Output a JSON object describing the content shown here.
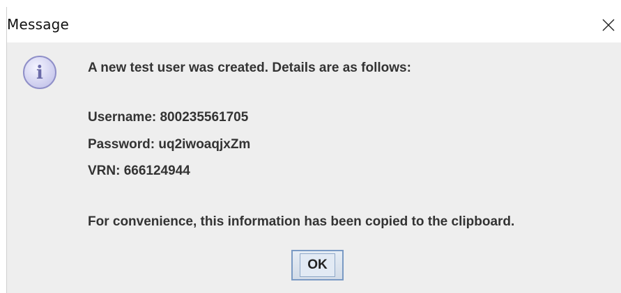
{
  "dialog": {
    "title": "Message",
    "close_icon": "close-icon",
    "info_icon": "info-icon",
    "info_icon_glyph": "i",
    "message": {
      "intro": "A new test user was created. Details are as follows:",
      "username": "Username: 800235561705",
      "password": "Password: uq2iwoaqjxZm",
      "vrn": "VRN: 666124944",
      "footer": "For convenience, this information has been copied to the clipboard."
    },
    "ok_label": "OK"
  },
  "colors": {
    "dialog_background": "#eeeeee",
    "titlebar_background": "#ffffff",
    "icon_fill": "#d6d6f0",
    "icon_border": "#8f8fc8",
    "ok_border": "#7a9ac4"
  }
}
